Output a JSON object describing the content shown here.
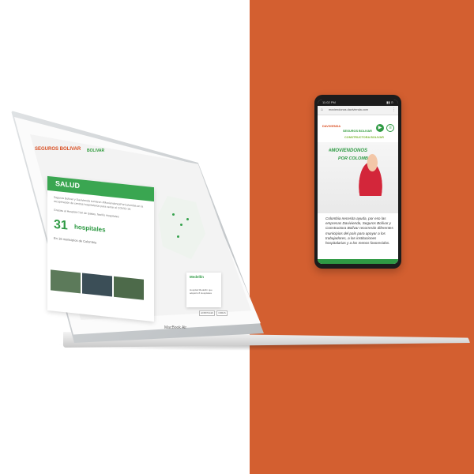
{
  "colors": {
    "accent_orange": "#d35f30",
    "brand_green": "#2f9a44"
  },
  "laptop": {
    "brand_logo_1": "SEGUROS BOLIVAR",
    "brand_logo_2": "BOLIVAR",
    "salud_title": "SALUD",
    "intro_text": "Seguros Bolívar y Davivienda sumaron #MoviendonosPorColombia en la recuperación de centros hospitalarios para cerrar el COVID-19.",
    "subintro_text": "Gracias al Hospital Civil de Ipiales, Nariño Hospitales",
    "hospital_count": "31",
    "hospital_label": "hospitales",
    "municipalities_text": "En 18 municipios de Colombia",
    "popup_title": "Medellín",
    "popup_text": "Hospital Medellín que adquirió 8 Hospitales",
    "btn_1": "HOSPITALES",
    "btn_2": "CIFRAS",
    "model_label": "MacBook Air"
  },
  "phone": {
    "status_time": "11:02 PM",
    "status_icons": "▮▮ ⊙",
    "url": "moviendonos.davivienda.com",
    "logo_1": "DAVIVIENDA",
    "logo_2": "SEGUROS BOLIVAR",
    "logo_3": "CONSTRUCTORA BOLIVAR",
    "tagline_1": "#MOVIENDONOS",
    "tagline_2": "POR COLOMBIA",
    "body_text": "Colombia necesita ayuda, por eso las empresas Davivienda, Seguros Bolívar y Constructora Bolívar recorrerán diferentes municipios del país para apoyar a los trabajadores, a las instituciones hospitalarias y a los menos favorecidos."
  }
}
